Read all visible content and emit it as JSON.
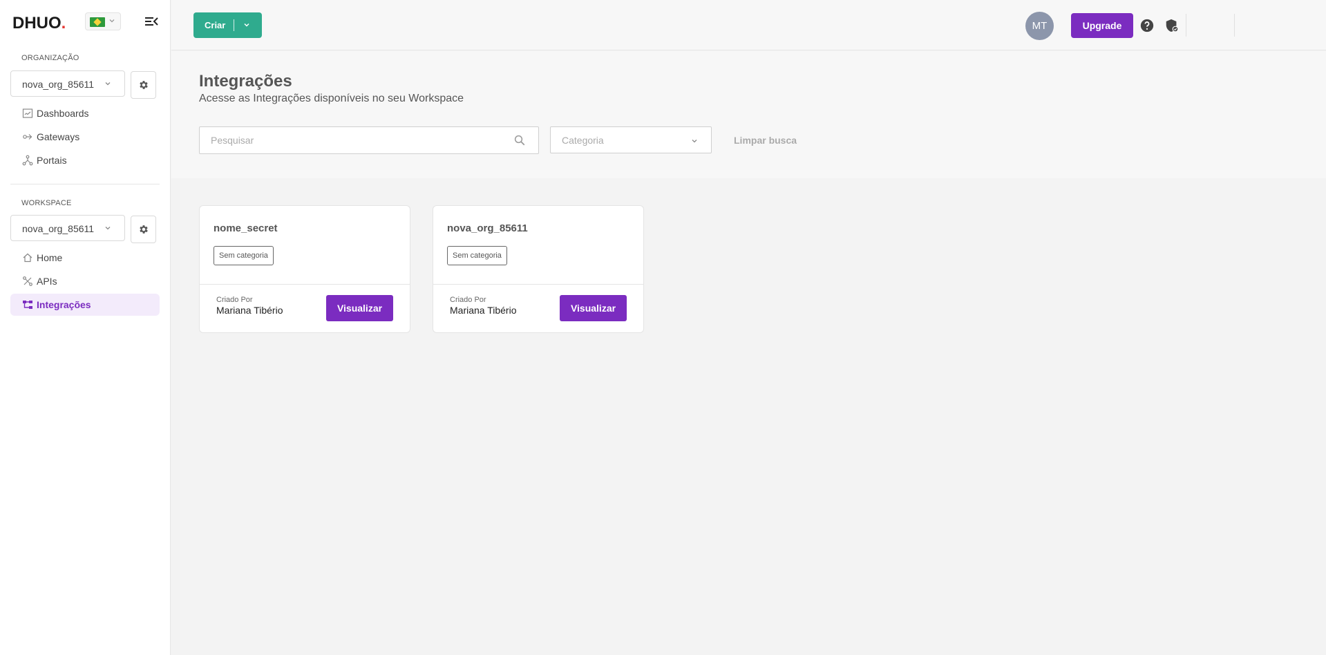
{
  "brand": {
    "logo_text": "DHUO",
    "logo_dot": "."
  },
  "sidebar": {
    "org_label": "ORGANIZAÇÃO",
    "org_select": "nova_org_85611",
    "org_items": [
      {
        "label": "Dashboards",
        "icon": "dashboard-icon"
      },
      {
        "label": "Gateways",
        "icon": "gateway-icon"
      },
      {
        "label": "Portais",
        "icon": "portal-icon"
      }
    ],
    "workspace_label": "WORKSPACE",
    "workspace_select": "nova_org_85611",
    "workspace_items": [
      {
        "label": "Home",
        "icon": "home-icon"
      },
      {
        "label": "APIs",
        "icon": "api-icon"
      },
      {
        "label": "Integrações",
        "icon": "integrations-icon",
        "active": true
      }
    ]
  },
  "topbar": {
    "create_label": "Criar",
    "avatar_initials": "MT",
    "upgrade_label": "Upgrade"
  },
  "header": {
    "title": "Integrações",
    "subtitle": "Acesse as Integrações disponíveis no seu Workspace",
    "search_placeholder": "Pesquisar",
    "category_placeholder": "Categoria",
    "clear_label": "Limpar busca"
  },
  "cards": [
    {
      "name": "nome_secret",
      "category": "Sem categoria",
      "created_by_label": "Criado Por",
      "created_by": "Mariana Tibério",
      "button": "Visualizar"
    },
    {
      "name": "nova_org_85611",
      "category": "Sem categoria",
      "created_by_label": "Criado Por",
      "created_by": "Mariana Tibério",
      "button": "Visualizar"
    }
  ],
  "colors": {
    "accent": "#7b2cc0",
    "create_button": "#2fab8e",
    "active_nav_bg": "#f3ebfb"
  }
}
